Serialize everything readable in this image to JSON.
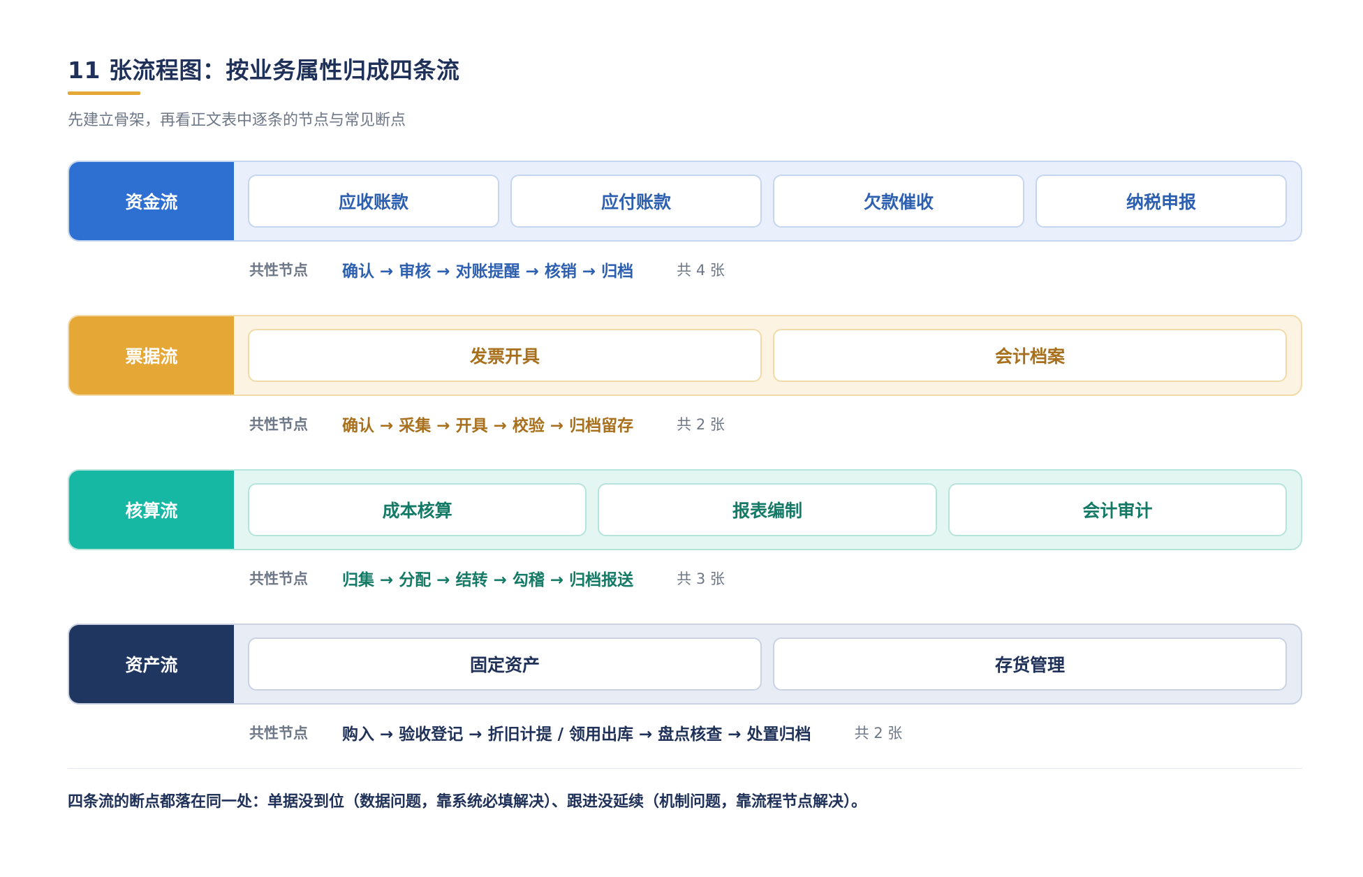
{
  "title": "11 张流程图：按业务属性归成四条流",
  "subtitle": "先建立骨架，再看正文表中逐条的节点与常见断点",
  "flows": [
    {
      "name": "资金流",
      "color": "#2e6fd2",
      "cards": [
        "应收账款",
        "应付账款",
        "欠款催收",
        "纳税申报"
      ],
      "nodes_label": "共性节点",
      "nodes": "确认 → 审核 → 对账提醒 → 核销 → 归档",
      "nodes_color": "#2d5fb0",
      "count": "共 4 张"
    },
    {
      "name": "票据流",
      "color": "#e5a735",
      "cards": [
        "发票开具",
        "会计档案"
      ],
      "nodes_label": "共性节点",
      "nodes": "确认 → 采集 → 开具 → 校验 → 归档留存",
      "nodes_color": "#a8701c",
      "count": "共 2 张"
    },
    {
      "name": "核算流",
      "color": "#16b8a3",
      "cards": [
        "成本核算",
        "报表编制",
        "会计审计"
      ],
      "nodes_label": "共性节点",
      "nodes": "归集 → 分配 → 结转 → 勾稽 → 归档报送",
      "nodes_color": "#137a66",
      "count": "共 3 张"
    },
    {
      "name": "资产流",
      "color": "#1f3660",
      "cards": [
        "固定资产",
        "存货管理"
      ],
      "nodes_label": "共性节点",
      "nodes": "购入 → 验收登记 → 折旧计提 / 领用出库 → 盘点核查 → 处置归档",
      "nodes_color": "#1f3158",
      "count": "共 2 张"
    }
  ],
  "footer": "四条流的断点都落在同一处：单据没到位（数据问题，靠系统必填解决）、跟进没延续（机制问题，靠流程节点解决）。"
}
